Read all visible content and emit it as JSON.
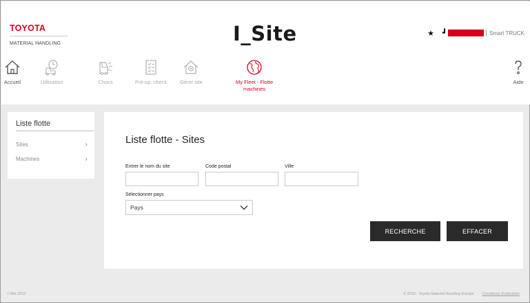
{
  "brand": {
    "logo_top": "TOYOTA",
    "logo_bottom": "MATERIAL HANDLING",
    "app_title": "I_Site",
    "accent_color": "#d5001c"
  },
  "user": {
    "favorite_icon": "star-icon",
    "person_icon": "user-icon",
    "product": "Smart TRUCK"
  },
  "nav": {
    "items": [
      {
        "label": "Accueil",
        "icon": "home-icon"
      },
      {
        "label": "Utilisation",
        "icon": "usage-icon"
      },
      {
        "label": "Chocs",
        "icon": "truck-impact-icon"
      },
      {
        "label": "Pré-op. check",
        "icon": "checklist-icon"
      },
      {
        "label": "Gérer site",
        "icon": "site-settings-icon"
      },
      {
        "label_line1": "My Fleet - Flotte",
        "label_line2": "machines",
        "icon": "globe-icon"
      }
    ],
    "help": {
      "label": "Aide",
      "icon": "help-icon"
    }
  },
  "sidebar": {
    "title": "Liste flotte",
    "items": [
      {
        "label": "Sites"
      },
      {
        "label": "Machines"
      }
    ]
  },
  "main": {
    "title": "Liste flotte - Sites",
    "fields": {
      "site_name_label": "Entrer le nom du site",
      "site_name_value": "",
      "postal_code_label": "Code postal",
      "postal_code_value": "",
      "city_label": "Ville",
      "city_value": "",
      "country_label": "Sélectionner pays",
      "country_value": "Pays"
    },
    "buttons": {
      "search": "RECHERCHE",
      "clear": "EFFACER"
    }
  },
  "footer": {
    "left": "I-Site 2012",
    "copyright": "© 2019 - Toyota Material Handling Europe",
    "terms": "Conditions d'utilisation"
  }
}
